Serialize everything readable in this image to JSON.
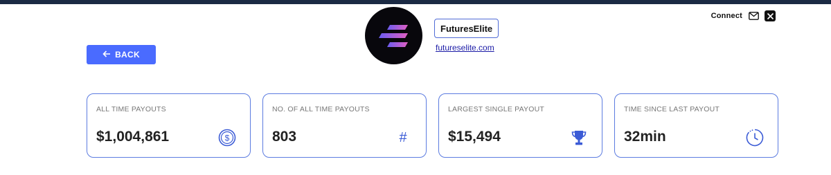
{
  "header": {
    "connect_label": "Connect",
    "connect_icons": [
      "mail-icon",
      "x-logo-icon"
    ],
    "back_label": "BACK"
  },
  "brand": {
    "name": "FuturesElite",
    "link": "futureselite.com"
  },
  "stats": [
    {
      "label": "ALL TIME PAYOUTS",
      "value": "$1,004,861",
      "icon": "dollar-coin-icon"
    },
    {
      "label": "NO. OF ALL TIME PAYOUTS",
      "value": "803",
      "icon": "hash-icon",
      "icon_glyph": "#"
    },
    {
      "label": "LARGEST SINGLE PAYOUT",
      "value": "$15,494",
      "icon": "trophy-icon"
    },
    {
      "label": "TIME SINCE LAST PAYOUT",
      "value": "32min",
      "icon": "clock-icon"
    }
  ],
  "colors": {
    "accent": "#4a6bff",
    "card_border": "#5b7be0",
    "top_strip": "#1b2a44"
  }
}
